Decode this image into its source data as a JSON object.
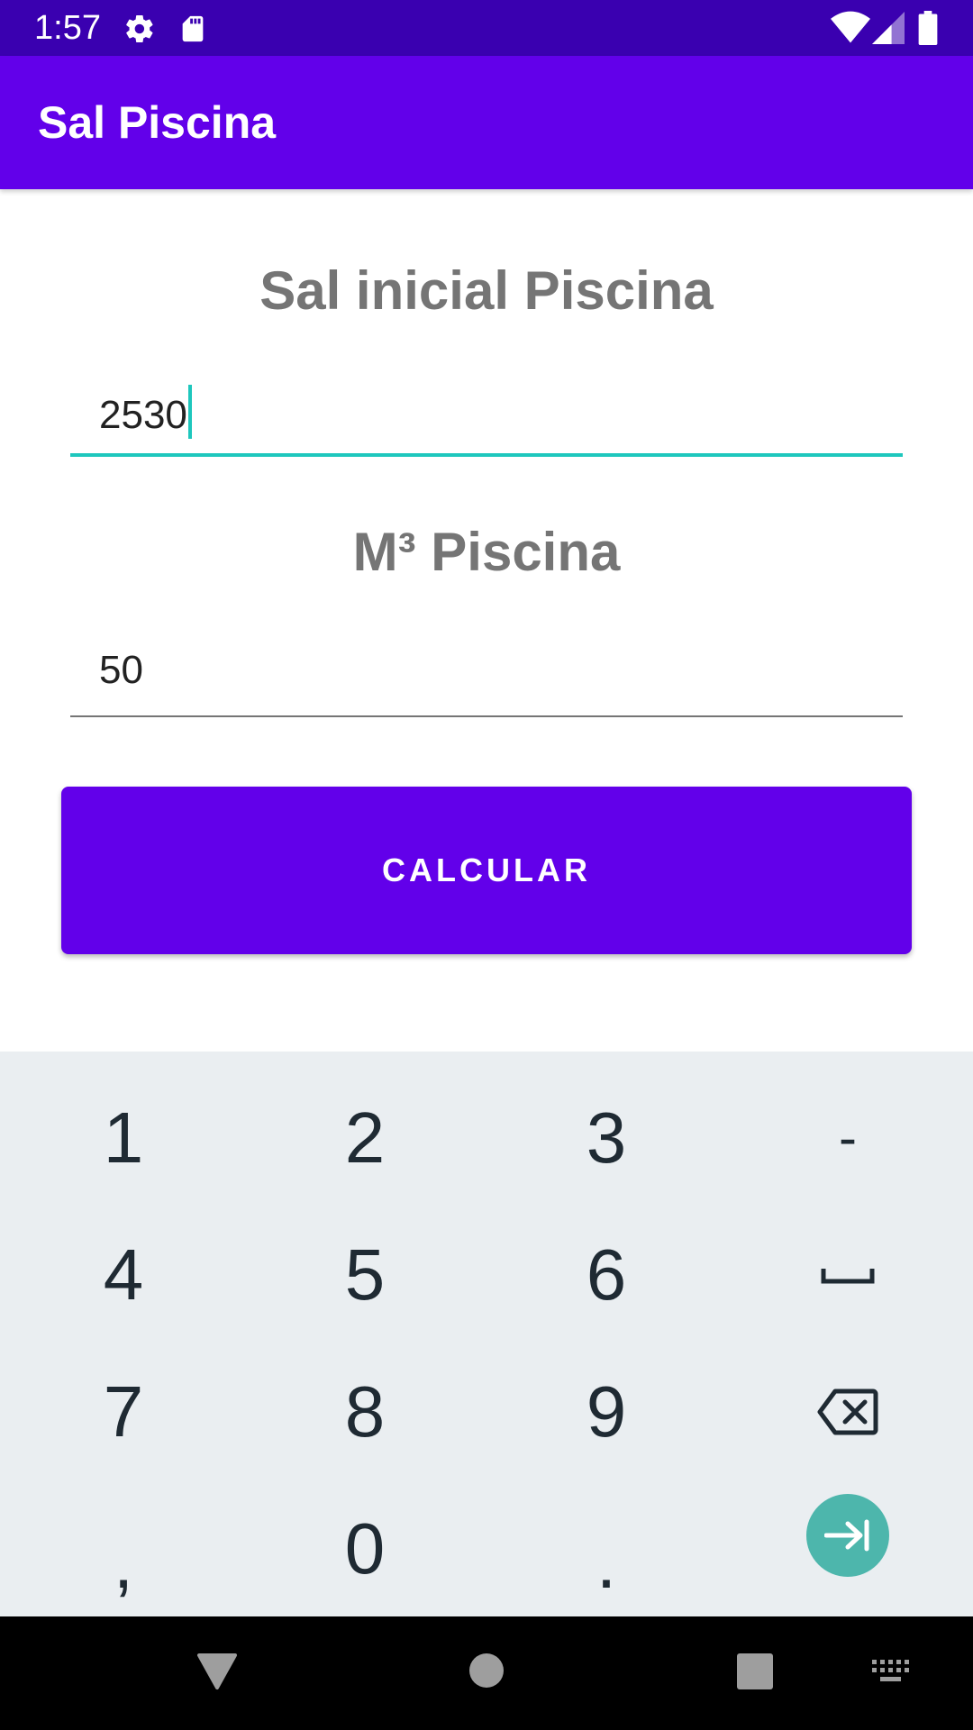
{
  "status_bar": {
    "time": "1:57",
    "icons": [
      "gear-icon",
      "sd-card-icon",
      "wifi-icon",
      "signal-icon",
      "battery-icon"
    ]
  },
  "app_bar": {
    "title": "Sal Piscina"
  },
  "form": {
    "salt_label": "Sal inicial Piscina",
    "salt_value": "2530",
    "volume_label": "M³ Piscina",
    "volume_value": "50",
    "button_label": "CALCULAR"
  },
  "keyboard": {
    "rows": [
      [
        "1",
        "2",
        "3",
        "-"
      ],
      [
        "4",
        "5",
        "6",
        "space-icon"
      ],
      [
        "7",
        "8",
        "9",
        "backspace-icon"
      ],
      [
        ",",
        "0",
        ".",
        "next-icon"
      ]
    ]
  },
  "nav_bar": {
    "icons": [
      "back-icon",
      "home-icon",
      "recents-icon",
      "keyboard-switch-icon"
    ]
  },
  "colors": {
    "status_bar": "#3a00b0",
    "primary": "#6200ea",
    "accent_teal": "#1ec7bd",
    "keyboard_bg": "#eaeef1",
    "go_key": "#4db6ac",
    "label_gray": "#757575"
  }
}
